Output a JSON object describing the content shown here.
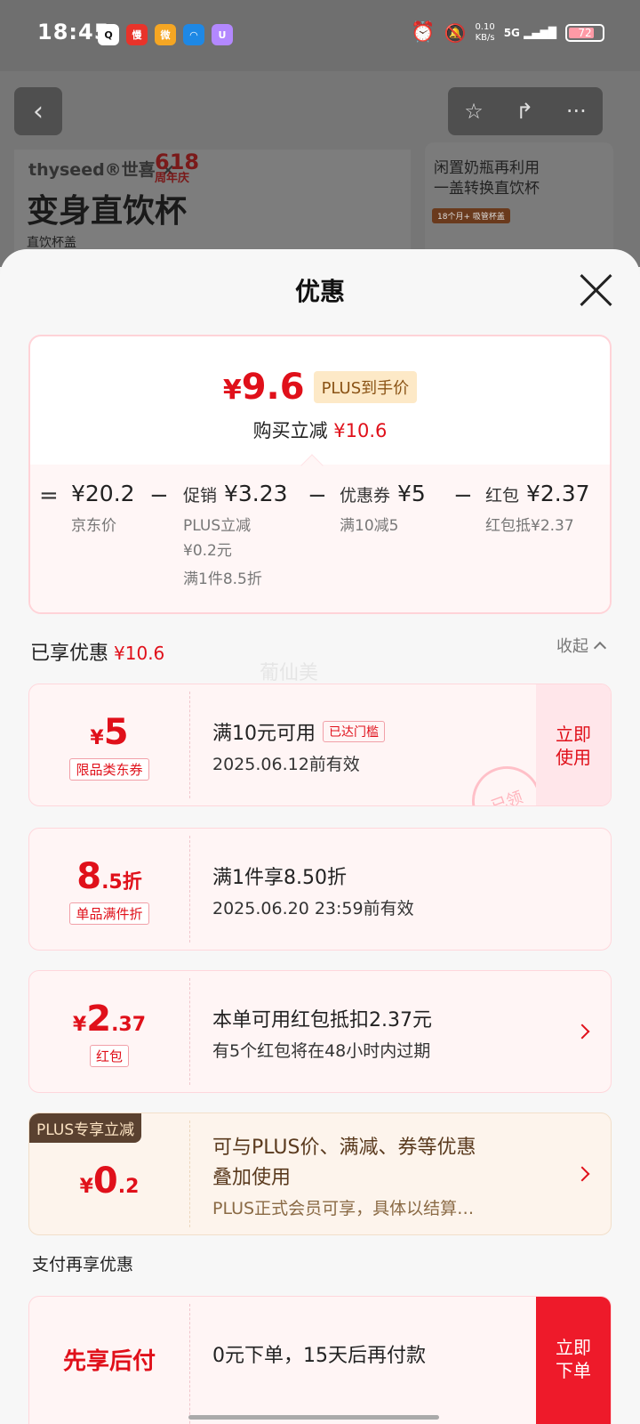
{
  "status_bar": {
    "time": "18:45",
    "net_speed": "0.10",
    "net_unit": "KB/s",
    "signal": "5G",
    "battery": "72"
  },
  "background_page": {
    "brand": "thyseed®世喜 ×",
    "anniversary": "618",
    "anniversary_sub": "周年庆",
    "title": "变身直饮杯",
    "subtitle": "直饮杯盖",
    "right_banner_line1": "闲置奶瓶再利用",
    "right_banner_line2": "一盖转换直饮杯",
    "right_banner_tag": "18个月+ 吸管杯盖"
  },
  "sheet": {
    "title": "优惠",
    "summary": {
      "final_price_symbol": "¥",
      "final_price": "9.6",
      "plus_tag": "PLUS到手价",
      "reduce_label": "购买立减",
      "reduce_amount": "¥10.6",
      "equals": "=",
      "minus": "−",
      "jd_price": "¥20.2",
      "jd_label": "京东价",
      "promo_label": "促销",
      "promo_amount": "¥3.23",
      "promo_sub1": "PLUS立减",
      "promo_sub2": "¥0.2元",
      "promo_sub3": "满1件8.5折",
      "coupon_label": "优惠券",
      "coupon_amount": "¥5",
      "coupon_sub": "满10减5",
      "redpacket_label": "红包",
      "redpacket_amount": "¥2.37",
      "redpacket_sub": "红包抵¥2.37"
    },
    "enjoyed_label": "已享优惠",
    "enjoyed_amount": "¥10.6",
    "collapse_label": "收起",
    "watermark": "葡仙美",
    "coupons": [
      {
        "yen": "¥",
        "amount": "5",
        "tag": "限品类东券",
        "line1": "满10元可用",
        "badge": "已达门槛",
        "line2": "2025.06.12前有效",
        "action": "立即使用",
        "stamp": "已领"
      },
      {
        "amount_big": "8",
        "amount_small": ".5折",
        "tag": "单品满件折",
        "line1": "满1件享8.50折",
        "line2": "2025.06.20 23:59前有效"
      },
      {
        "yen": "¥",
        "amount_big": "2",
        "amount_small": ".37",
        "tag": "红包",
        "line1": "本单可用红包抵扣2.37元",
        "line2": "有5个红包将在48小时内过期"
      },
      {
        "badge": "PLUS专享立减",
        "yen": "¥",
        "amount_big": "0",
        "amount_small": ".2",
        "line1": "可与PLUS价、满减、券等优惠",
        "line1b": "叠加使用",
        "line2": "PLUS正式会员可享，具体以结算…"
      }
    ],
    "pay_section_label": "支付再享优惠",
    "pay": {
      "name": "先享后付",
      "desc": "0元下单，15天后再付款",
      "action": "立即下单"
    }
  },
  "colors": {
    "accent_red": "#e0101a",
    "plus_gold": "#8a5315",
    "overlay_gray": "#6f6f6f"
  }
}
